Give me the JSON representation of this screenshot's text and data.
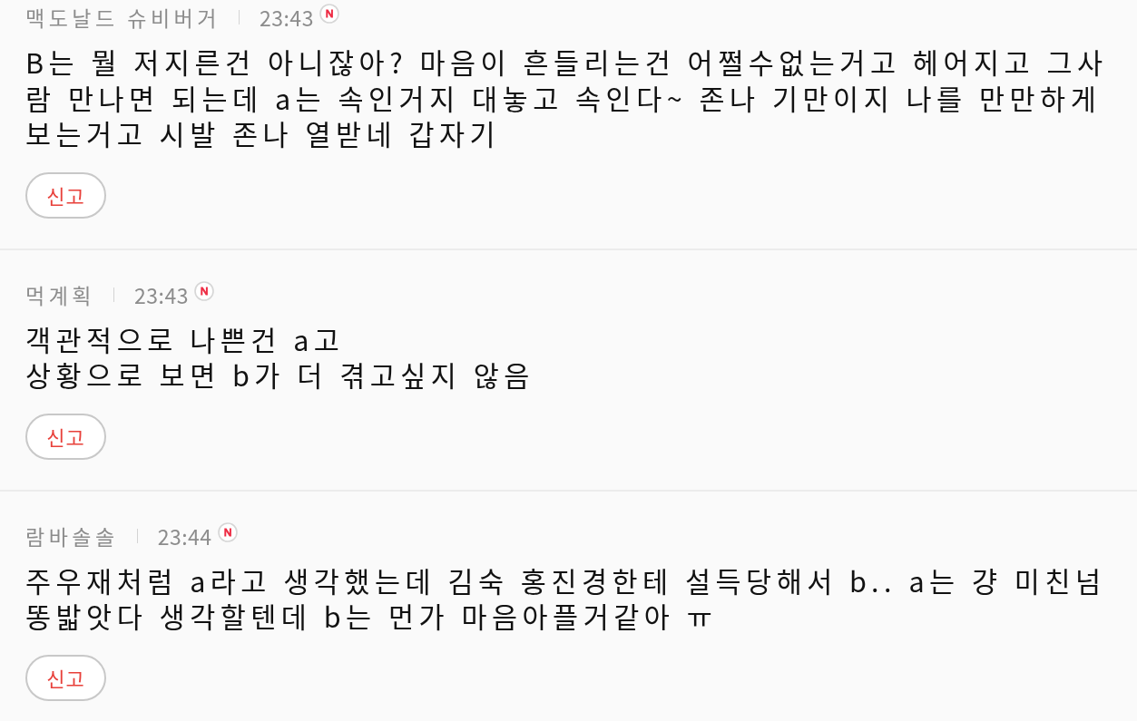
{
  "comments": [
    {
      "author": "맥도날드 슈비버거",
      "time": "23:43",
      "new": true,
      "body": "B는 뭘 저지른건 아니잖아? 마음이 흔들리는건 어쩔수없는거고 헤어지고 그사람 만나면 되는데 a는 속인거지 대놓고 속인다~ 존나 기만이지 나를 만만하게 보는거고 시발 존나 열받네 갑자기",
      "report": "신고"
    },
    {
      "author": "먹계획",
      "time": "23:43",
      "new": true,
      "body": "객관적으로 나쁜건 a고\n상황으로 보면 b가 더 겪고싶지 않음",
      "report": "신고"
    },
    {
      "author": "람바솔솔",
      "time": "23:44",
      "new": true,
      "body": "주우재처럼 a라고 생각했는데 김숙 홍진경한테 설득당해서 b.. a는 걍 미친넘 똥밟앗다 생각할텐데 b는 먼가 마음아플거같아 ㅠ",
      "report": "신고"
    }
  ]
}
